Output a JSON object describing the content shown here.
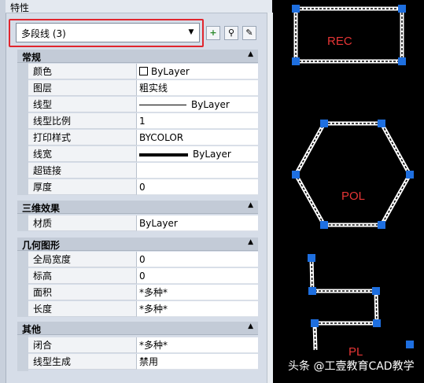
{
  "panel": {
    "title": "特性",
    "selector": "多段线 (3)",
    "toolbar": [
      "select-objects-icon",
      "quick-select-icon",
      "toggle-pickadd-icon"
    ]
  },
  "sections": {
    "general": {
      "title": "常规",
      "rows": [
        {
          "key": "颜色",
          "value": "ByLayer"
        },
        {
          "key": "图层",
          "value": "粗实线"
        },
        {
          "key": "线型",
          "value": "ByLayer"
        },
        {
          "key": "线型比例",
          "value": "1"
        },
        {
          "key": "打印样式",
          "value": "BYCOLOR"
        },
        {
          "key": "线宽",
          "value": "ByLayer"
        },
        {
          "key": "超链接",
          "value": ""
        },
        {
          "key": "厚度",
          "value": "0"
        }
      ]
    },
    "threed": {
      "title": "三维效果",
      "rows": [
        {
          "key": "材质",
          "value": "ByLayer"
        }
      ]
    },
    "geometry": {
      "title": "几何图形",
      "rows": [
        {
          "key": "全局宽度",
          "value": "0"
        },
        {
          "key": "标高",
          "value": "0"
        },
        {
          "key": "面积",
          "value": "*多种*"
        },
        {
          "key": "长度",
          "value": "*多种*"
        }
      ]
    },
    "misc": {
      "title": "其他",
      "rows": [
        {
          "key": "闭合",
          "value": "*多种*"
        },
        {
          "key": "线型生成",
          "value": "禁用"
        }
      ]
    }
  },
  "canvas": {
    "labels": {
      "rec": "REC",
      "pol": "POL",
      "pl": "PL"
    }
  },
  "watermark": "头条 @工壹教育CAD教学",
  "colors": {
    "grip": "#1e6fe0",
    "label": "#e63535",
    "highlight": "#e0262e"
  }
}
